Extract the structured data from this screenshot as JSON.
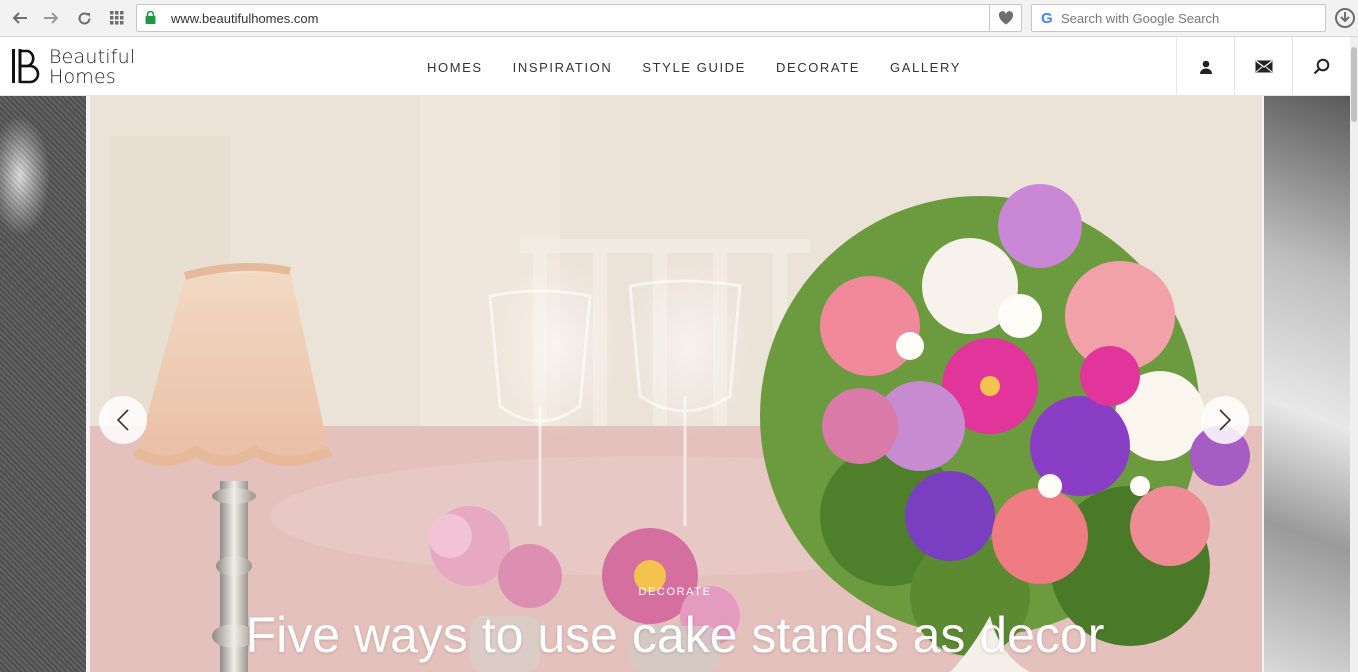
{
  "browser": {
    "url": "www.beautifulhomes.com",
    "search_placeholder": "Search with Google Search",
    "icons": [
      "back-icon",
      "forward-icon",
      "reload-icon",
      "apps-icon",
      "lock-icon",
      "heart-icon",
      "google-icon",
      "download-icon"
    ]
  },
  "site": {
    "logo": {
      "line1": "Beautiful",
      "line2": "Homes"
    },
    "nav": [
      "HOMES",
      "INSPIRATION",
      "STYLE GUIDE",
      "DECORATE",
      "GALLERY"
    ],
    "header_icons": [
      "user-icon",
      "mail-icon",
      "search-icon"
    ]
  },
  "hero": {
    "category": "DECORATE",
    "title": "Five ways to use cake stands as decor",
    "colors": {
      "caption": "#ffffff",
      "accent": "#d94f8a"
    }
  }
}
